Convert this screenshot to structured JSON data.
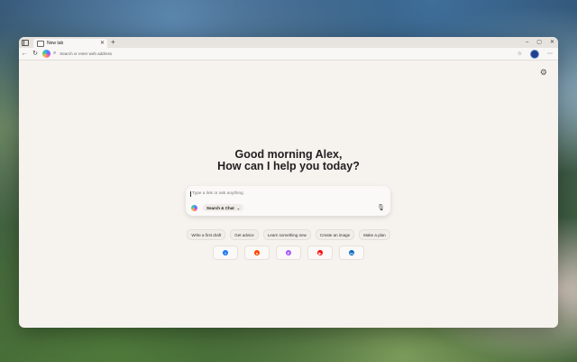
{
  "tab": {
    "title": "New tab"
  },
  "window_controls": {
    "minimize": "–",
    "maximize": "▢",
    "close": "✕"
  },
  "address_bar": {
    "placeholder": "Search or enter web address"
  },
  "greeting": {
    "line1": "Good morning Alex,",
    "line2": "How can I help you today?"
  },
  "chat": {
    "placeholder": "Type a link or ask anything",
    "mode_label": "Search & Chat"
  },
  "suggestions": [
    "Write a first draft",
    "Get advice",
    "Learn something new",
    "Create an image",
    "Make a plan"
  ],
  "shortcuts": [
    {
      "icon": "facebook-icon",
      "glyph": "f",
      "color": "#1877f2"
    },
    {
      "icon": "reddit-icon",
      "glyph": "●",
      "color": "#ff4500"
    },
    {
      "icon": "figma-icon",
      "glyph": "F",
      "color": "#a259ff"
    },
    {
      "icon": "youtube-icon",
      "glyph": "▶",
      "color": "#ff0000"
    },
    {
      "icon": "linkedin-icon",
      "glyph": "in",
      "color": "#0a66c2"
    }
  ]
}
